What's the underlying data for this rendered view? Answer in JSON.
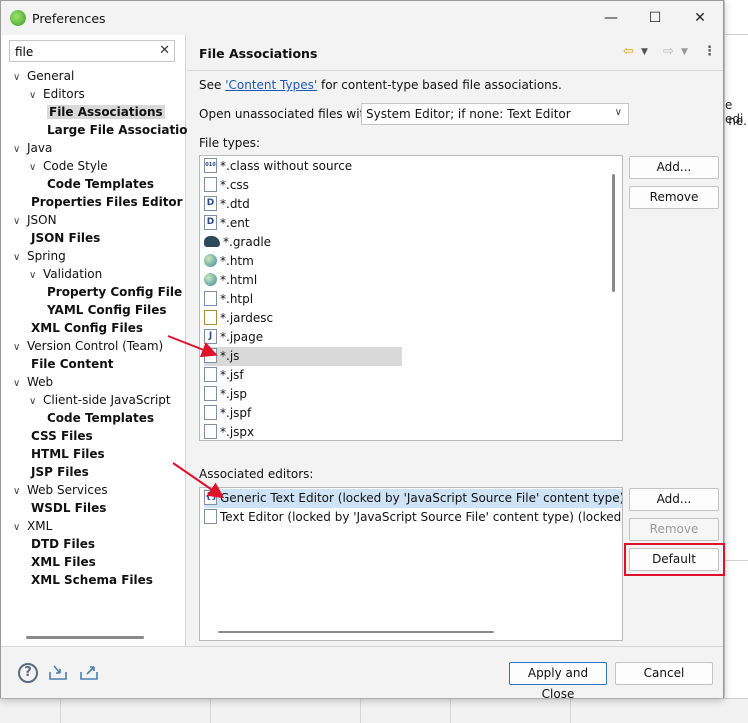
{
  "window": {
    "title": "Preferences",
    "minimize": "—",
    "maximize": "☐",
    "close": "✕"
  },
  "filter": {
    "value": "file",
    "clear": "✕"
  },
  "tree": [
    {
      "label": "General",
      "level": 0,
      "twisty": "∨",
      "bold": false
    },
    {
      "label": "Editors",
      "level": 1,
      "twisty": "∨",
      "bold": false
    },
    {
      "label": "File Associations",
      "level": 2,
      "twisty": "",
      "bold": true,
      "selected": true
    },
    {
      "label": "Large File Associations",
      "level": 2,
      "twisty": "",
      "bold": true
    },
    {
      "label": "Java",
      "level": 0,
      "twisty": "∨",
      "bold": false
    },
    {
      "label": "Code Style",
      "level": 1,
      "twisty": "∨",
      "bold": false
    },
    {
      "label": "Code Templates",
      "level": 2,
      "twisty": "",
      "bold": true
    },
    {
      "label": "Properties Files Editor",
      "level": 1,
      "twisty": "",
      "bold": true
    },
    {
      "label": "JSON",
      "level": 0,
      "twisty": "∨",
      "bold": false
    },
    {
      "label": "JSON Files",
      "level": 1,
      "twisty": "",
      "bold": true
    },
    {
      "label": "Spring",
      "level": 0,
      "twisty": "∨",
      "bold": false
    },
    {
      "label": "Validation",
      "level": 1,
      "twisty": "∨",
      "bold": false
    },
    {
      "label": "Property Config File",
      "level": 2,
      "twisty": "",
      "bold": true
    },
    {
      "label": "YAML Config Files",
      "level": 2,
      "twisty": "",
      "bold": true
    },
    {
      "label": "XML Config Files",
      "level": 1,
      "twisty": "",
      "bold": true
    },
    {
      "label": "Version Control (Team)",
      "level": 0,
      "twisty": "∨",
      "bold": false
    },
    {
      "label": "File Content",
      "level": 1,
      "twisty": "",
      "bold": true
    },
    {
      "label": "Web",
      "level": 0,
      "twisty": "∨",
      "bold": false
    },
    {
      "label": "Client-side JavaScript",
      "level": 1,
      "twisty": "∨",
      "bold": false
    },
    {
      "label": "Code Templates",
      "level": 2,
      "twisty": "",
      "bold": true
    },
    {
      "label": "CSS Files",
      "level": 1,
      "twisty": "",
      "bold": true
    },
    {
      "label": "HTML Files",
      "level": 1,
      "twisty": "",
      "bold": true
    },
    {
      "label": "JSP Files",
      "level": 1,
      "twisty": "",
      "bold": true
    },
    {
      "label": "Web Services",
      "level": 0,
      "twisty": "∨",
      "bold": false
    },
    {
      "label": "WSDL Files",
      "level": 1,
      "twisty": "",
      "bold": true
    },
    {
      "label": "XML",
      "level": 0,
      "twisty": "∨",
      "bold": false
    },
    {
      "label": "DTD Files",
      "level": 1,
      "twisty": "",
      "bold": true
    },
    {
      "label": "XML Files",
      "level": 1,
      "twisty": "",
      "bold": true
    },
    {
      "label": "XML Schema Files",
      "level": 1,
      "twisty": "",
      "bold": true
    }
  ],
  "page": {
    "title": "File Associations",
    "see_prefix": "See ",
    "see_link": "'Content Types'",
    "see_suffix": " for content-type based file associations.",
    "open_label": "Open unassociated files with:",
    "open_value": "System Editor; if none: Text Editor",
    "file_types_label": "File types:",
    "associated_label": "Associated editors:"
  },
  "file_types": [
    {
      "label": "*.class without source",
      "icon": "class"
    },
    {
      "label": "*.css",
      "icon": "file"
    },
    {
      "label": "*.dtd",
      "icon": "letter-d"
    },
    {
      "label": "*.ent",
      "icon": "letter-d"
    },
    {
      "label": "*.gradle",
      "icon": "gradle"
    },
    {
      "label": "*.htm",
      "icon": "globe"
    },
    {
      "label": "*.html",
      "icon": "globe"
    },
    {
      "label": "*.htpl",
      "icon": "file"
    },
    {
      "label": "*.jardesc",
      "icon": "jar"
    },
    {
      "label": "*.jpage",
      "icon": "letter-j"
    },
    {
      "label": "*.js",
      "icon": "file",
      "selected": true
    },
    {
      "label": "*.jsf",
      "icon": "file"
    },
    {
      "label": "*.jsp",
      "icon": "file"
    },
    {
      "label": "*.jspf",
      "icon": "file"
    },
    {
      "label": "*.jspx",
      "icon": "file"
    }
  ],
  "associated_editors": [
    {
      "label": "Generic Text Editor (locked by 'JavaScript Source File' content type) (locked by",
      "icon": "generic-editor",
      "selected": true
    },
    {
      "label": "Text Editor (locked by 'JavaScript Source File' content type) (locked by 'Ja",
      "icon": "file"
    }
  ],
  "buttons": {
    "add_types": "Add...",
    "remove_types": "Remove",
    "add_editors": "Add...",
    "remove_editors": "Remove",
    "default": "Default",
    "apply_close": "Apply and Close",
    "cancel": "Cancel"
  },
  "background_fragments": [
    "e edi",
    "ne."
  ],
  "colors": {
    "highlight": "#e0112b",
    "link": "#1f57b7",
    "selection": "#d9d9d9"
  }
}
